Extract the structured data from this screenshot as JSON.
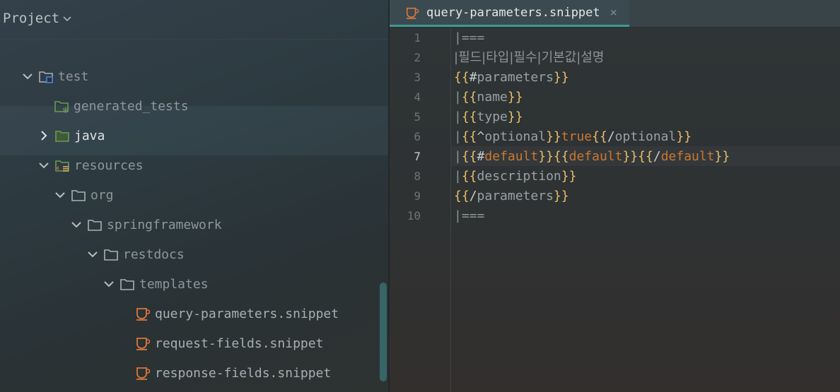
{
  "project_panel": {
    "title": "Project",
    "tree": [
      {
        "label": "test",
        "chevron": "down",
        "icon": "test-folder-icon",
        "color": "gray"
      },
      {
        "label": "generated_tests",
        "chevron": "none",
        "icon": "generated-folder-icon",
        "color": "gray"
      },
      {
        "label": "java",
        "chevron": "right",
        "icon": "source-folder-icon",
        "color": "light"
      },
      {
        "label": "resources",
        "chevron": "down",
        "icon": "resources-folder-icon",
        "color": "gray"
      },
      {
        "label": "org",
        "chevron": "down",
        "icon": "folder-icon",
        "color": "gray"
      },
      {
        "label": "springframework",
        "chevron": "down",
        "icon": "folder-icon",
        "color": "gray"
      },
      {
        "label": "restdocs",
        "chevron": "down",
        "icon": "folder-icon",
        "color": "gray"
      },
      {
        "label": "templates",
        "chevron": "down",
        "icon": "folder-icon",
        "color": "gray"
      },
      {
        "label": "query-parameters.snippet",
        "chevron": "none",
        "icon": "snippet-file-icon",
        "color": "file"
      },
      {
        "label": "request-fields.snippet",
        "chevron": "none",
        "icon": "snippet-file-icon",
        "color": "file"
      },
      {
        "label": "response-fields.snippet",
        "chevron": "none",
        "icon": "snippet-file-icon",
        "color": "file"
      }
    ]
  },
  "editor": {
    "tab": {
      "label": "query-parameters.snippet",
      "close": "×"
    },
    "current_line": 7,
    "lines": [
      {
        "no": "1",
        "text": "|==="
      },
      {
        "no": "2",
        "text": "|필드|타입|필수|기본값|설명"
      },
      {
        "no": "3",
        "text": "{{#parameters}}"
      },
      {
        "no": "4",
        "text": "|{{name}}"
      },
      {
        "no": "5",
        "text": "|{{type}}"
      },
      {
        "no": "6",
        "text": "|{{^optional}}true{{/optional}}"
      },
      {
        "no": "7",
        "text": "|{{#default}}{{default}}{{/default}}"
      },
      {
        "no": "8",
        "text": "|{{description}}"
      },
      {
        "no": "9",
        "text": "{{/parameters}}"
      },
      {
        "no": "10",
        "text": "|==="
      }
    ]
  },
  "colors": {
    "accent": "#3d9a91",
    "template_brace": "#e8bf6a",
    "template_keyword": "#cc7832",
    "folder_green": "#6a9955",
    "snippet_orange": "#d9773b"
  }
}
